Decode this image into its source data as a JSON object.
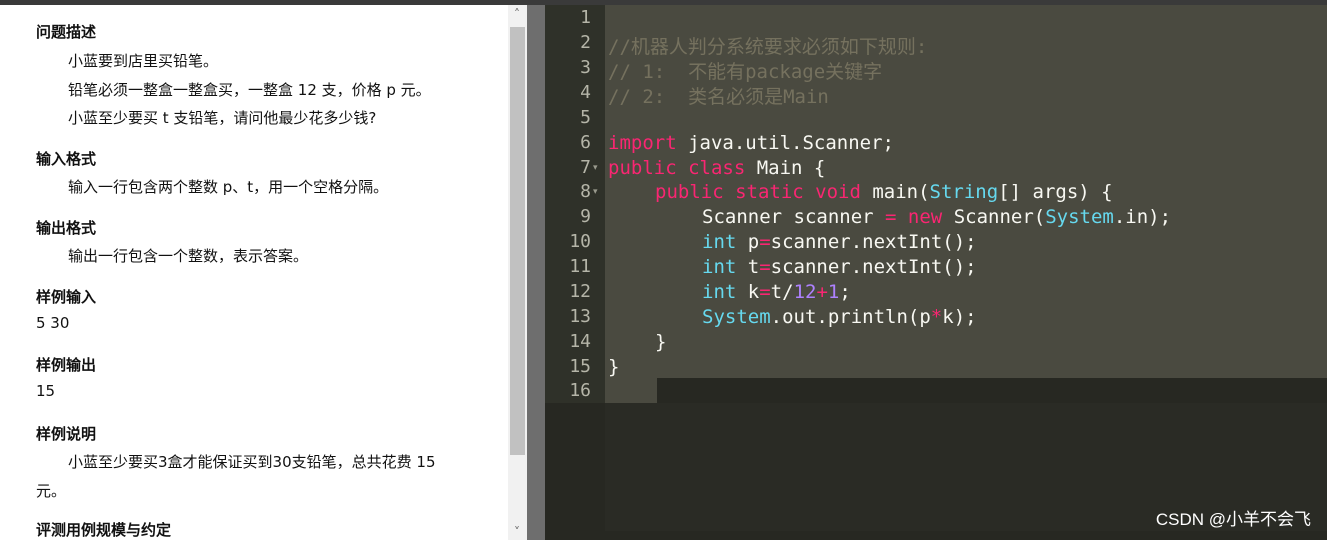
{
  "problem": {
    "sections": {
      "desc_title": "问题描述",
      "desc_line1": "小蓝要到店里买铅笔。",
      "desc_line2": "铅笔必须一整盒一整盒买，一整盒 12 支，价格 p 元。",
      "desc_line3": "小蓝至少要买 t 支铅笔，请问他最少花多少钱?",
      "input_title": "输入格式",
      "input_text": "输入一行包含两个整数 p、t，用一个空格分隔。",
      "output_title": "输出格式",
      "output_text": "输出一行包含一个整数，表示答案。",
      "sample_in_title": "样例输入",
      "sample_in": "5 30",
      "sample_out_title": "样例输出",
      "sample_out": "15",
      "explain_title": "样例说明",
      "explain_line1": "小蓝至少要买3盒才能保证买到30支铅笔，总共花费 15",
      "explain_line2": "元。",
      "scale_title": "评测用例规模与约定"
    }
  },
  "editor": {
    "line_numbers": [
      "1",
      "2",
      "3",
      "4",
      "5",
      "6",
      "7",
      "8",
      "9",
      "10",
      "11",
      "12",
      "13",
      "14",
      "15",
      "16"
    ],
    "lines": {
      "l2": "//机器人判分系统要求必须如下规则:",
      "l3": "// 1:  不能有package关键字",
      "l4": "// 2:  类名必须是Main",
      "l6_kw": "import",
      "l6_rest": " java.util.Scanner;",
      "l7_kw": "public class",
      "l7_rest": " Main {",
      "l8_kw": "public static void",
      "l8_a": " main(",
      "l8_typ": "String",
      "l8_b": "[] args) {",
      "l9_a": "Scanner scanner ",
      "l9_op": "=",
      "l9_kw": " new",
      "l9_b": " Scanner(",
      "l9_typ": "System",
      "l9_c": ".in);",
      "l10_typ": "int",
      "l10_a": " p",
      "l10_op": "=",
      "l10_b": "scanner.nextInt();",
      "l11_typ": "int",
      "l11_a": " t",
      "l11_op": "=",
      "l11_b": "scanner.nextInt();",
      "l12_typ": "int",
      "l12_a": " k",
      "l12_op": "=",
      "l12_b": "t/",
      "l12_n1": "12",
      "l12_op2": "+",
      "l12_n2": "1",
      "l12_c": ";",
      "l13_typ": "System",
      "l13_a": ".out.println(p",
      "l13_op": "*",
      "l13_b": "k);",
      "l14": "}",
      "l15": "}"
    }
  },
  "watermark": "CSDN @小羊不会飞",
  "colors": {
    "editor_bg": "#272822",
    "keyword": "#f92672",
    "type": "#66d9ef",
    "comment": "#75715e",
    "number": "#ae81ff"
  }
}
